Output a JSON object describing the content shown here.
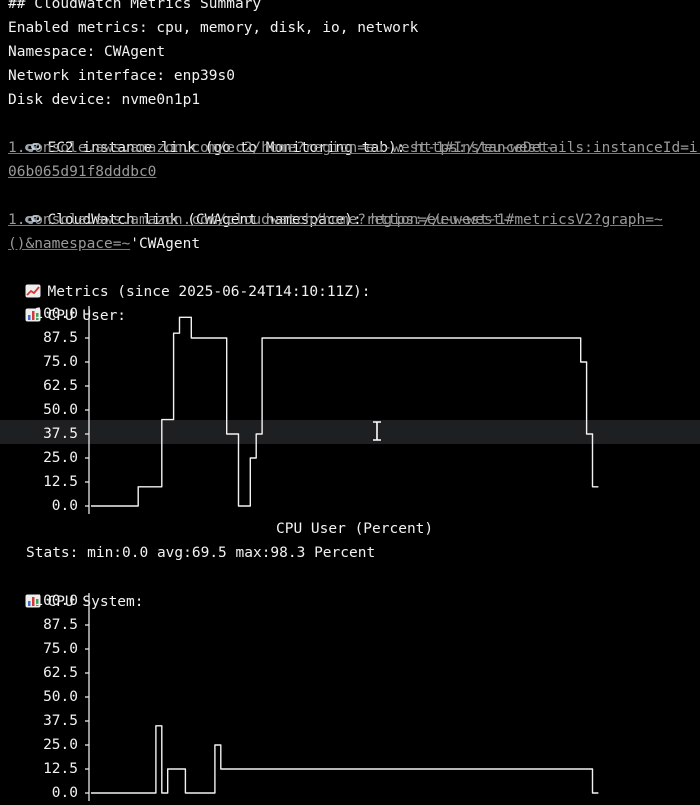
{
  "lines": {
    "heading": "## CloudWatch Metrics Summary",
    "enabled": "Enabled metrics: cpu, memory, disk, io, network",
    "namespace": "Namespace: CWAgent",
    "interface": "Network interface: enp39s0",
    "disk": "Disk device: nvme0n1p1",
    "ec2_label": "EC2 instance link (go to Monitoring tab): ",
    "ec2_url_1": "https://eu-west-",
    "ec2_url_2": "1.console.aws.amazon.com/ec2/home?region=eu-west-1#InstanceDetails:instanceId=i-",
    "ec2_url_3": "06b065d91f8dddbc0",
    "cw_label": "CloudWatch link (CWAgent namespace): ",
    "cw_url_1": "https://eu-west-",
    "cw_url_2": "1.console.aws.amazon.com/cloudwatch/home?region=eu-west-1#metricsV2?graph=~",
    "cw_url_3": "()&namespace=~",
    "cw_url_tail": "'CWAgent",
    "metrics_since": "Metrics (since 2025-06-24T14:10:11Z):",
    "cpu_user_title": "CPU User:",
    "cpu_system_title": "CPU System:"
  },
  "icons": {
    "link": "link-icon",
    "metrics": "chart-increasing-icon",
    "bar": "bar-chart-icon"
  },
  "colors": {
    "background": "#000000",
    "text": "#f2f2f2",
    "link": "#9a9a9a",
    "highlight_row": "#1e1f20"
  },
  "chart_data": [
    {
      "type": "line",
      "title": "CPU User:",
      "caption": "CPU User (Percent)",
      "stats": "Stats: min:0.0 avg:69.5 max:98.3 Percent",
      "y_ticks": [
        "100.0",
        "87.5",
        "75.0",
        "62.5",
        "50.0",
        "37.5",
        "25.0",
        "12.5",
        "0.0"
      ],
      "ylim": [
        0,
        100
      ],
      "grid": false,
      "series": [
        {
          "points": [
            [
              0,
              0
            ],
            [
              8,
              0
            ],
            [
              8,
              10
            ],
            [
              12,
              10
            ],
            [
              12,
              45
            ],
            [
              14,
              45
            ],
            [
              14,
              90
            ],
            [
              15,
              90
            ],
            [
              15,
              98.3
            ],
            [
              17,
              98.3
            ],
            [
              17,
              87.5
            ],
            [
              23,
              87.5
            ],
            [
              23,
              37.5
            ],
            [
              25,
              37.5
            ],
            [
              25,
              0
            ],
            [
              27,
              0
            ],
            [
              27,
              25
            ],
            [
              28,
              25
            ],
            [
              28,
              37.5
            ],
            [
              29,
              37.5
            ],
            [
              29,
              87.5
            ],
            [
              83,
              87.5
            ],
            [
              83,
              75
            ],
            [
              84,
              75
            ],
            [
              84,
              37.5
            ],
            [
              85,
              37.5
            ],
            [
              85,
              10
            ],
            [
              86,
              10
            ]
          ]
        }
      ]
    },
    {
      "type": "line",
      "title": "CPU System:",
      "y_ticks": [
        "100.0",
        "87.5",
        "75.0",
        "62.5",
        "50.0",
        "37.5",
        "25.0",
        "12.5",
        "0.0"
      ],
      "ylim": [
        0,
        100
      ],
      "grid": false,
      "series": [
        {
          "points": [
            [
              0,
              0
            ],
            [
              11,
              0
            ],
            [
              11,
              35
            ],
            [
              12,
              35
            ],
            [
              12,
              0
            ],
            [
              13,
              0
            ],
            [
              13,
              12.5
            ],
            [
              16,
              12.5
            ],
            [
              16,
              0
            ],
            [
              21,
              0
            ],
            [
              21,
              25
            ],
            [
              22,
              25
            ],
            [
              22,
              12.5
            ],
            [
              85,
              12.5
            ],
            [
              85,
              0
            ],
            [
              86,
              0
            ]
          ]
        }
      ]
    }
  ]
}
